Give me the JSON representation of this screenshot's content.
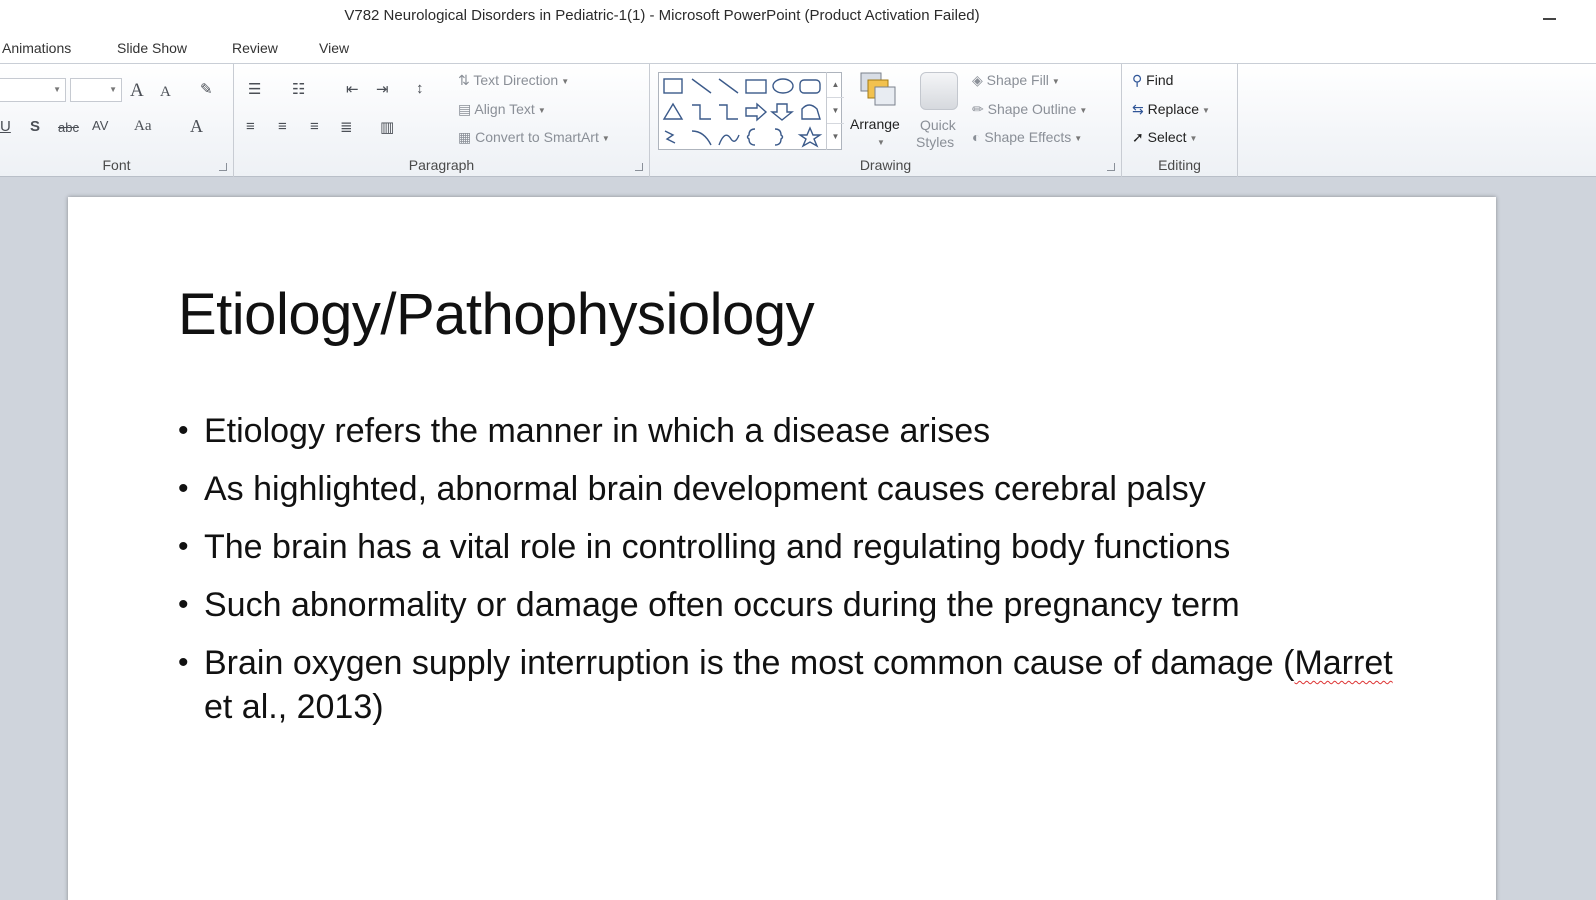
{
  "window": {
    "title": "V782 Neurological Disorders in Pediatric-1(1)  -  Microsoft PowerPoint (Product Activation Failed)"
  },
  "tabs": [
    {
      "label": "Animations"
    },
    {
      "label": "Slide Show"
    },
    {
      "label": "Review"
    },
    {
      "label": "View"
    }
  ],
  "ribbon": {
    "font": {
      "label": "Font",
      "grow_label": "A",
      "shrink_label": "A",
      "underline_label": "U",
      "shadow_label": "S",
      "strike_label": "abc",
      "spacing_label": "AV",
      "case_label": "Aa",
      "color_label": "A"
    },
    "paragraph": {
      "label": "Paragraph",
      "text_direction": "Text Direction",
      "align_text": "Align Text",
      "smartart": "Convert to SmartArt"
    },
    "drawing": {
      "label": "Drawing",
      "arrange": "Arrange",
      "quick_styles_1": "Quick",
      "quick_styles_2": "Styles",
      "shape_fill": "Shape Fill",
      "shape_outline": "Shape Outline",
      "shape_effects": "Shape Effects"
    },
    "editing": {
      "label": "Editing",
      "find": "Find",
      "replace": "Replace",
      "select": "Select"
    }
  },
  "slide": {
    "title": "Etiology/Pathophysiology",
    "bullets": [
      "Etiology refers the manner in which a disease arises",
      "As highlighted, abnormal brain development causes cerebral palsy",
      "The brain has a vital role in controlling and regulating body functions",
      "Such abnormality or damage often occurs during the pregnancy term"
    ],
    "last_bullet": {
      "before": "Brain oxygen supply interruption is the most common cause of damage (",
      "misspelled": "Marret",
      "after": " et al., 2013)"
    }
  }
}
